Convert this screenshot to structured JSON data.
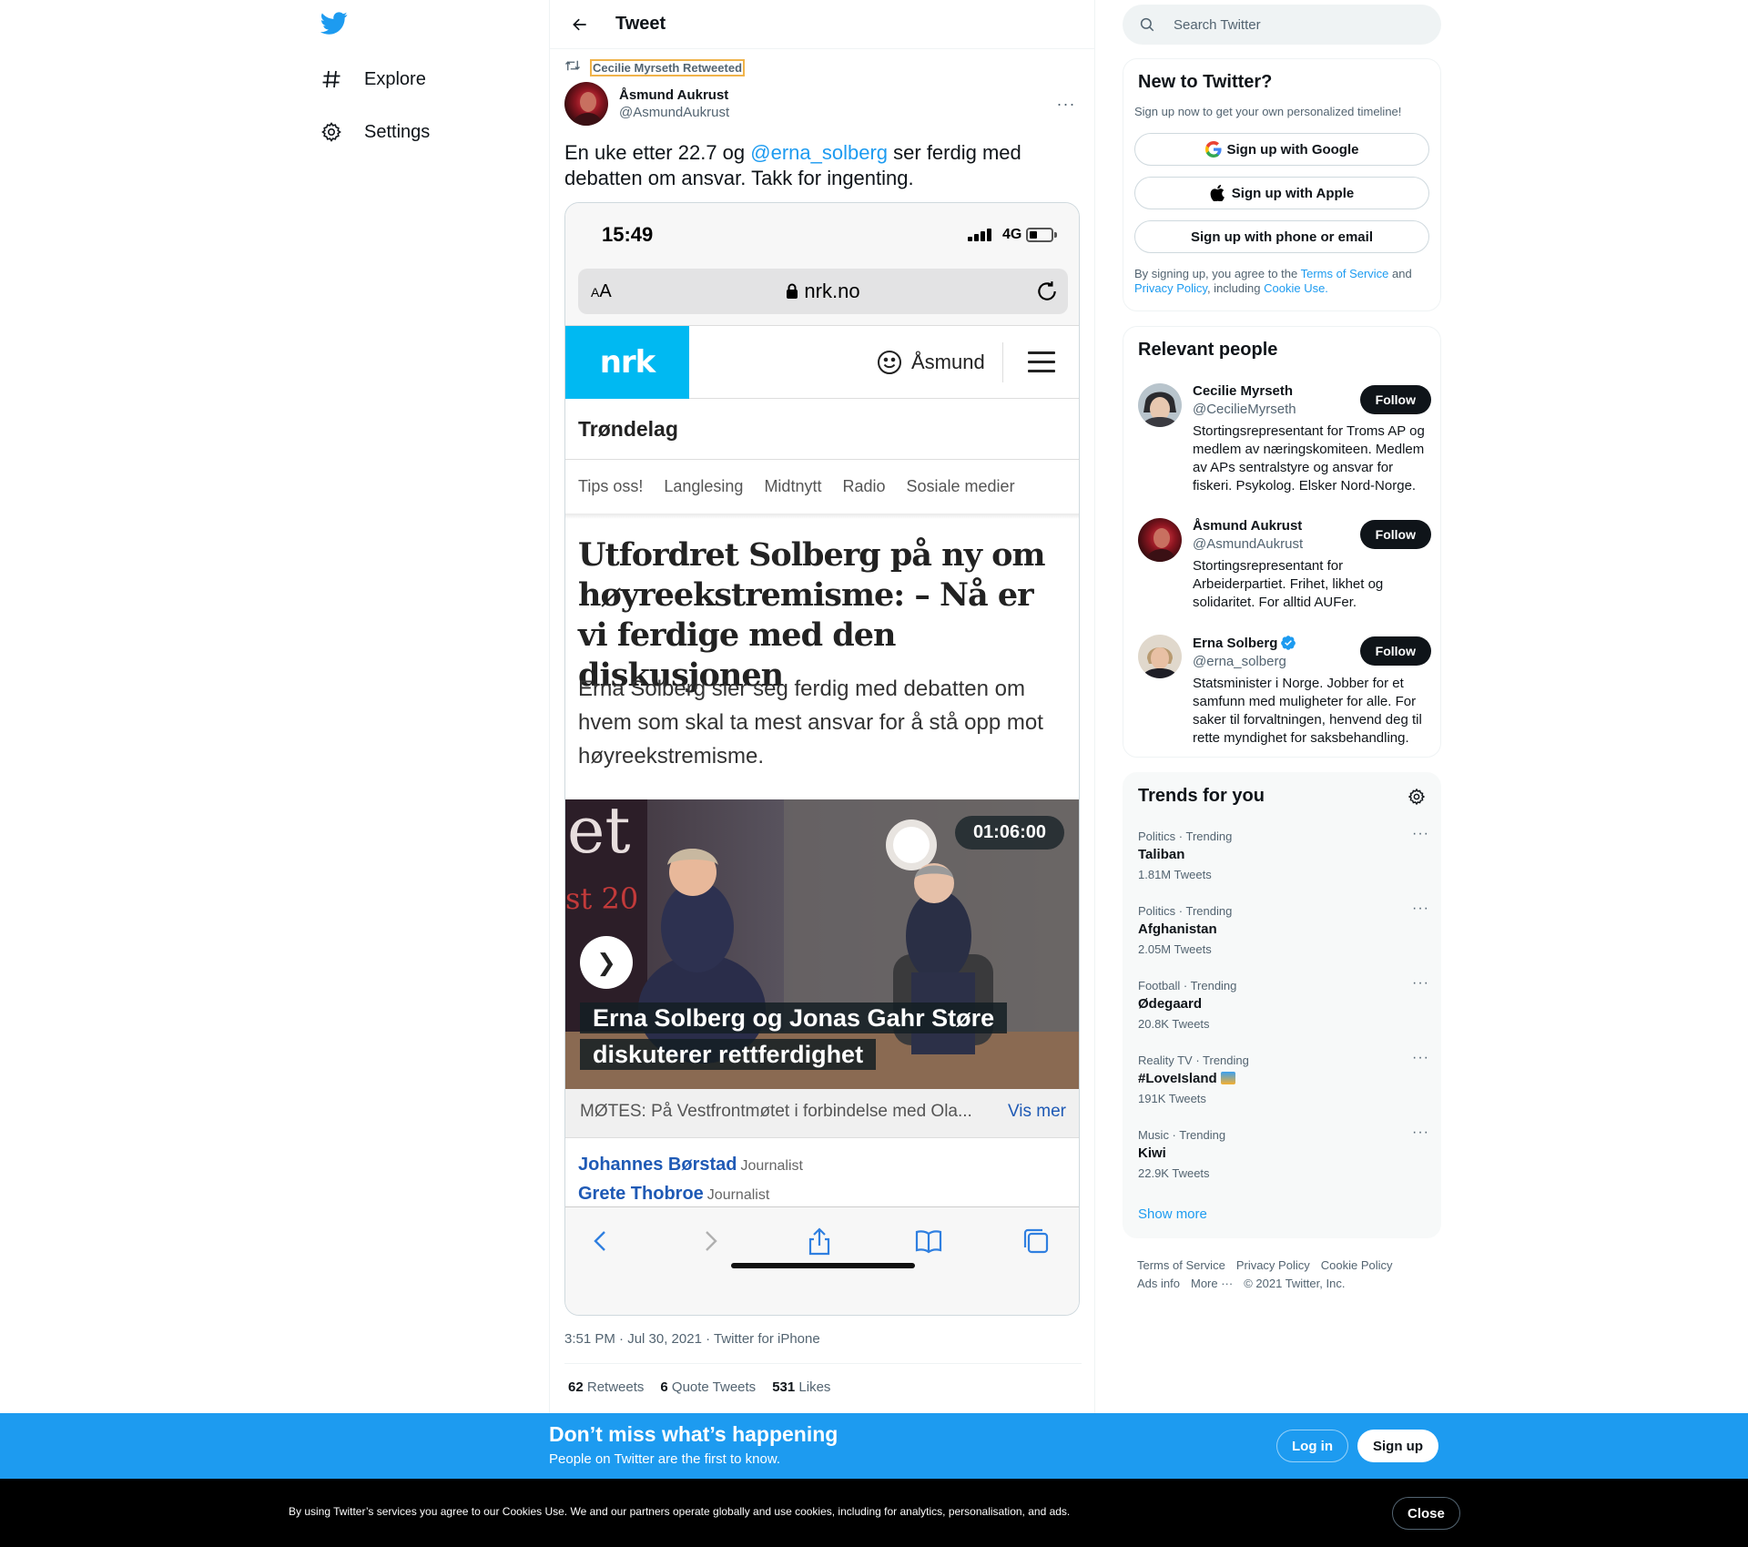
{
  "nav": {
    "explore_label": "Explore",
    "settings_label": "Settings"
  },
  "header": {
    "title": "Tweet"
  },
  "tweet": {
    "retweeted_by": "Cecilie Myrseth Retweeted",
    "author_name": "Åsmund Aukrust",
    "author_handle": "@AsmundAukrust",
    "text_before": "En uke etter 22.7 og ",
    "mention": "@erna_solberg",
    "text_after": " ser ferdig med debatten om ansvar. Takk for ingenting.",
    "meta": "3:51 PM · Jul 30, 2021 · Twitter for iPhone",
    "retweets_count": "62",
    "retweets_label": "Retweets",
    "quotes_count": "6",
    "quotes_label": "Quote Tweets",
    "likes_count": "531",
    "likes_label": "Likes"
  },
  "screenshot": {
    "time": "15:49",
    "network": "4G",
    "aa_small": "A",
    "aa_large": "A",
    "domain": "nrk.no",
    "logo": "nrk",
    "user": "Åsmund",
    "region": "Trøndelag",
    "subnav": [
      "Tips oss!",
      "Langlesing",
      "Midtnytt",
      "Radio",
      "Sosiale medier"
    ],
    "headline": "Utfordret Solberg på ny om høyreekstremisme: – Nå er vi ferdige med den diskusjonen",
    "lead": "Erna Solberg sier seg ferdig med debatten om hvem som skal ta mest ansvar for å stå opp mot høyreekstremisme.",
    "video_duration": "01:06:00",
    "video_title": "Erna Solberg og Jonas Gahr Støre diskuterer rettferdighet",
    "bg_text": "et",
    "bg_text2": "st 20",
    "caption": "MØTES: På Vestfrontmøtet i forbindelse med Ola...",
    "caption_more": "Vis mer",
    "bylines": [
      {
        "name": "Johannes Børstad",
        "role": "Journalist"
      },
      {
        "name": "Grete Thobroe",
        "role": "Journalist"
      }
    ]
  },
  "search": {
    "placeholder": "Search Twitter"
  },
  "new_to_twitter": {
    "title": "New to Twitter?",
    "subtitle": "Sign up now to get your own personalized timeline!",
    "google": "Sign up with Google",
    "apple": "Sign up with Apple",
    "phone": "Sign up with phone or email",
    "legal_1": "By signing up, you agree to the ",
    "tos": "Terms of Service",
    "legal_2": " and ",
    "privacy": "Privacy Policy",
    "legal_3": ", including ",
    "cookie": "Cookie Use."
  },
  "relevant_people": {
    "title": "Relevant people",
    "follow_label": "Follow",
    "people": [
      {
        "name": "Cecilie Myrseth",
        "handle": "@CecilieMyrseth",
        "bio": "Stortingsrepresentant for Troms AP og medlem av næringskomiteen. Medlem av APs sentralstyre og ansvar for fiskeri. Psykolog. Elsker Nord-Norge."
      },
      {
        "name": "Åsmund Aukrust",
        "handle": "@AsmundAukrust",
        "bio": "Stortingsrepresentant for Arbeiderpartiet. Frihet, likhet og solidaritet. For alltid AUFer."
      },
      {
        "name": "Erna Solberg",
        "handle": "@erna_solberg",
        "bio": "Statsminister i Norge. Jobber for et samfunn med muligheter for alle. For saker til forvaltningen, henvend deg til rette myndighet for saksbehandling."
      }
    ]
  },
  "trends": {
    "title": "Trends for you",
    "items": [
      {
        "category": "Politics · Trending",
        "name": "Taliban",
        "count": "1.81M Tweets"
      },
      {
        "category": "Politics · Trending",
        "name": "Afghanistan",
        "count": "2.05M Tweets"
      },
      {
        "category": "Football · Trending",
        "name": "Ødegaard",
        "count": "20.8K Tweets"
      },
      {
        "category": "Reality TV · Trending",
        "name": "#LoveIsland",
        "count": "191K Tweets"
      },
      {
        "category": "Music · Trending",
        "name": "Kiwi",
        "count": "22.9K Tweets"
      }
    ],
    "show_more": "Show more"
  },
  "footer": {
    "tos": "Terms of Service",
    "privacy": "Privacy Policy",
    "cookie": "Cookie Policy",
    "ads": "Ads info",
    "more": "More ···",
    "copyright": "© 2021 Twitter, Inc."
  },
  "banner": {
    "title": "Don’t miss what’s happening",
    "subtitle": "People on Twitter are the first to know.",
    "login": "Log in",
    "signup": "Sign up"
  },
  "cookie_banner": {
    "text": "By using Twitter’s services you agree to our Cookies Use. We and our partners operate globally and use cookies, including for analytics, personalisation, and ads.",
    "close": "Close"
  },
  "colors": {
    "accent": "#1d9bf0",
    "nrk_blue": "#00b9f2",
    "text_primary": "#0f1419",
    "text_secondary": "#536471"
  },
  "icons": {
    "logo": "twitter-bird-icon",
    "explore": "hashtag-icon",
    "settings": "gear-icon",
    "back": "arrow-left-icon",
    "retweet": "retweet-icon",
    "search": "search-icon"
  }
}
